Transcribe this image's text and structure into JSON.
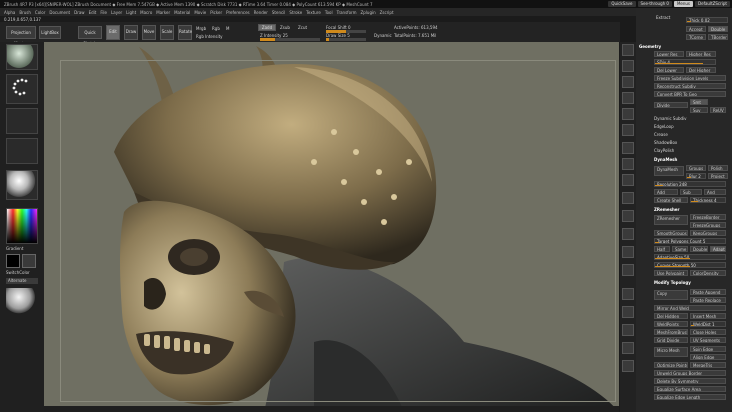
{
  "title_bar": {
    "text": "ZBrush 4R7 P3 [x64][SNIPER-WOL] ZBrush Document  ◆ Free Mem 7.547GB ◆ Active Mem 1390 ◆ Scratch Disk 7731 ◆ RTime 3.64 Timer 0.084 ◆ PolyCount 613.594 KP ◆ MeshCount 7",
    "buttons": [
      "QuickSave",
      "See-through 0",
      "Menus",
      "DefaultZScript"
    ]
  },
  "menu_bar": [
    "Alpha",
    "Brush",
    "Color",
    "Document",
    "Draw",
    "Edit",
    "File",
    "Layer",
    "Light",
    "Macro",
    "Marker",
    "Material",
    "Movie",
    "Picker",
    "Preferences",
    "Render",
    "Stencil",
    "Stroke",
    "Texture",
    "Tool",
    "Transform",
    "Zplugin",
    "Zscript"
  ],
  "coords": "0.219,0.657,0.137",
  "toolbar": {
    "projection_master": "Projection Master",
    "lightbox": "LightBox",
    "quick_sketch": "Quick Sketch",
    "edit": "Edit",
    "draw": "Draw",
    "move": "Move",
    "scale": "Scale",
    "rotate": "Rotate",
    "mrgb": "Mrgb",
    "rgb": "Rgb",
    "m": "M",
    "zadd": "Zadd",
    "zsub": "Zsub",
    "zcut": "Zcut",
    "rgb_intensity": "Rgb Intensity",
    "z_intensity": "Z Intensity 25",
    "focal_shift": "Focal Shift 0",
    "draw_size": "Draw Size 5",
    "dynamic": "Dynamic",
    "active_points": "ActivePoints: 613,594",
    "total_points": "TotalPoints: 7.651 Mil"
  },
  "left_shelf": {
    "gradient": "Gradient",
    "switch_color": "SwitchColor",
    "alternate": "Alternate"
  },
  "right_panel": {
    "extract": "Extract",
    "thick": "Thick 0.02",
    "accept": "Accept",
    "double": "Double",
    "tcorne": "TCorne",
    "tborder": "TBorder",
    "geometry": "Geometry",
    "lower_res": "Lower Res",
    "higher_res": "Higher Res",
    "sdiv": "SDiv 4",
    "del_lower": "Del Lower",
    "del_higher": "Del Higher",
    "freeze_subdiv": "Freeze Subdivision Levels",
    "reconstruct_subdiv": "Reconstruct Subdiv",
    "convert_bpr": "Convert BPR To Geo",
    "divide": "Divide",
    "smt": "Smt",
    "suv": "Suv",
    "reuv": "ReUV",
    "dynamic_subdiv": "Dynamic Subdiv",
    "edgeloop": "EdgeLoop",
    "crease": "Crease",
    "shadowbox": "ShadowBox",
    "claypolish": "ClayPolish",
    "dynamesh": "DynaMesh",
    "dynamesh2": "DynaMesh",
    "groups": "Groups",
    "polish": "Polish",
    "blur": "Blur 2",
    "project": "Project",
    "resolution": "Resolution 248",
    "add": "Add",
    "sub": "Sub",
    "and": "And",
    "create_shell": "Create Shell",
    "thickness": "Thickness 4",
    "zremesher": "ZRemesher",
    "freeze_border": "FreezeBorder",
    "freeze_groups": "FreezeGroups",
    "smooth_groups": "SmoothGroups",
    "keep_groups": "KeepGroups",
    "target_polygons": "Target Polygons Count 5",
    "half": "Half",
    "same": "Same",
    "double2": "Double",
    "adapt": "Adapt",
    "adaptive_size": "AdaptiveSize 50",
    "curves_strength": "Curves Strength 50",
    "use_polypaint": "Use Polypaint",
    "color_density": "ColorDensity",
    "modify_topology": "Modify Topology",
    "copy": "Copy",
    "paste_append": "Paste Append",
    "paste_replace": "Paste Replace",
    "mirror_and_weld": "Mirror And Weld",
    "del_hidden": "Del Hidden",
    "insert_mesh": "Insert Mesh",
    "weld_points": "WeldPoints",
    "weld_dist": "WeldDist 1",
    "mesh_from_brush": "MeshFromBrush",
    "close_holes": "Close Holes",
    "grid_divide": "Grid Divide",
    "uv_segments": "UV Segments",
    "micro_mesh": "Micro Mesh",
    "spin_edge": "Spin Edge",
    "align_edge": "Align Edge",
    "optimize_points": "Optimize Points",
    "merge_tris": "MergeTris",
    "unweld_groups_border": "Unweld Groups Border",
    "delete_by_symmetry": "Delete By Symmetry",
    "equalize_surface_area": "Equalize Surface Area",
    "equalize_edge_length": "Equalize Edge Length"
  },
  "colors": {
    "accent": "#d08a1c",
    "viewport_bg": "#6f6f62",
    "panel_bg": "#272727"
  }
}
